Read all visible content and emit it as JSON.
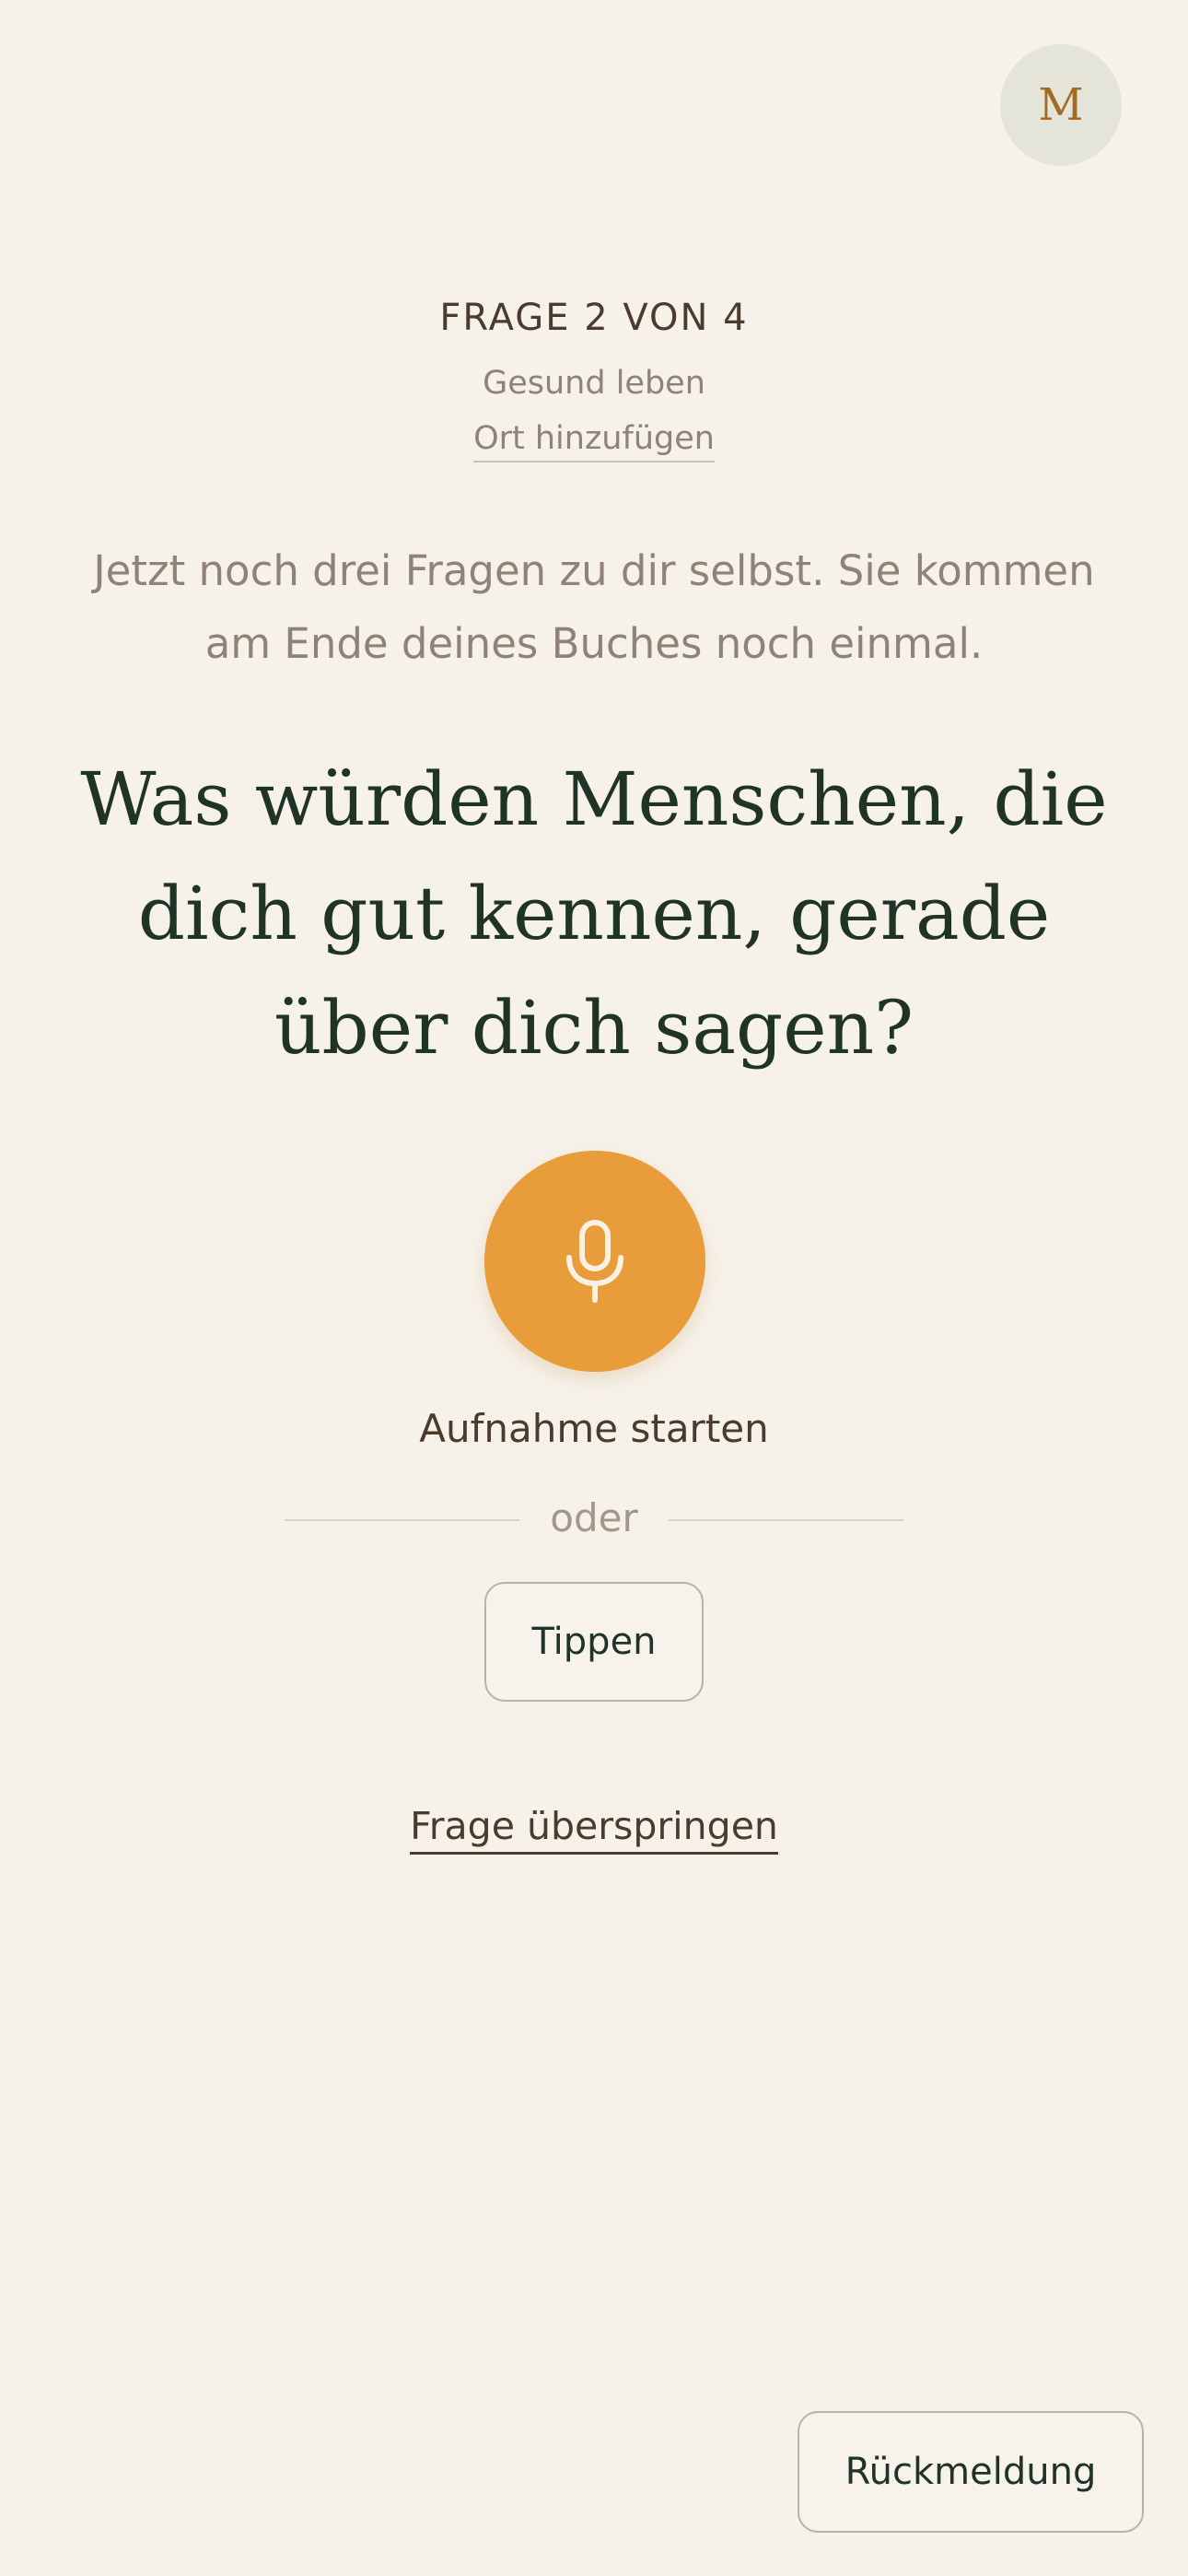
{
  "header": {
    "avatar_initial": "M"
  },
  "question_meta": {
    "progress_label": "FRAGE 2 VON 4",
    "category": "Gesund leben",
    "add_location_label": "Ort hinzufügen"
  },
  "intro_text": "Jetzt noch drei Fragen zu dir selbst. Sie kommen am Ende deines Buches noch einmal.",
  "question_text": "Was würden Menschen, die dich gut kennen, gerade über dich sagen?",
  "recording": {
    "icon": "microphone-icon",
    "label": "Aufnahme starten",
    "accent_color": "#e89c3a"
  },
  "divider_label": "oder",
  "type_button_label": "Tippen",
  "skip_label": "Frage überspringen",
  "feedback_button_label": "Rückmeldung"
}
